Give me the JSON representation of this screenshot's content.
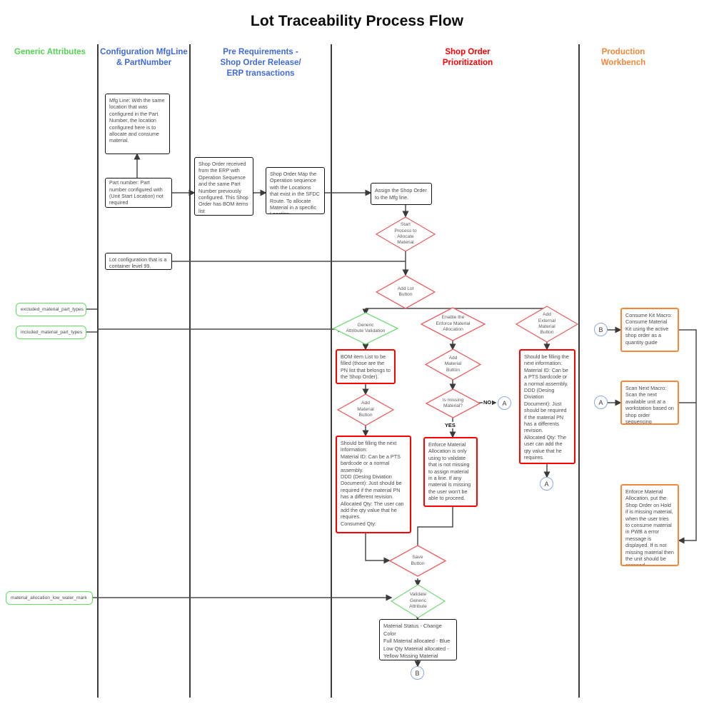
{
  "page": {
    "title": "Lot Traceability Process Flow",
    "background": "#ffffff"
  },
  "colors": {
    "lane_generic": "#55d455",
    "lane_config": "#4169e1",
    "lane_prereq": "#4169e1",
    "lane_shoporder": "#ff0000",
    "lane_workbench": "#f5873a",
    "box_black": "#111111",
    "box_red": "#ff0000",
    "box_orange": "#f5873a",
    "box_green": "#5fe05f",
    "diamond_red": "#f06060",
    "diamond_green": "#7bd97b",
    "connector": "#8fa7e0",
    "edge": "#4a4a4a"
  },
  "lanes": [
    {
      "id": "generic",
      "label": "Generic Attributes"
    },
    {
      "id": "config",
      "label": "Configuration MfgLine\n& PartNumber"
    },
    {
      "id": "prereq",
      "label": "Pre Requirements -\nShop Order Release/\nERP transactions"
    },
    {
      "id": "shoporder",
      "label": "Shop Order\nPrioritization"
    },
    {
      "id": "workbench",
      "label": "Production\nWorkbench"
    }
  ],
  "nodes": {
    "mfg_line": "Mfg Line: With the same location that was configured in the Part Number, the location configured here is to allocate and consume material.",
    "part_number": "Part number: Part number configured with (Unit Start Location) not required",
    "shop_order_erp": "Shop Order received from the ERP with Operation Sequence and the same Part Number previously configured. This Shop Order has BOM items list",
    "shop_order_map": "Shop Order Map the Operation sequence with the Locations that exist in the SFDC Route. To allocate Material in a specific Location",
    "assign_shop_order": "Assign the Shop Order to the Mfg line.",
    "lot_configuration": "Lot configuration that is a container level 99.",
    "excluded_material_part_types": "excluded_material_part_types",
    "included_material_part_types": "included_material_part_types",
    "material_allocation_low_water_mark": "material_allocation_low_water_mark",
    "bom_item_list": "BOM item List to be filled (those are the PN list that belongs to the Shop Order).",
    "should_be_filling_left": "Should be filling the next information:\nMaterial ID: Can be a PTS bardcode or a normal assembly.\nDDD (Desing Diviation Document): Just should be required if the material PN has a different revision.\nAllocated Qty: The user can add the qty value that he requires.\nConsumed Qty:",
    "enforce_material_allocation_note": "Enforce Material Allocation is only using to validate that is not missing to assign material in a line. If any material is missing the user won't be able to proceed.",
    "should_be_filling_right": "Should be filling the next information:\nMaterial ID: Can be a PTS bardcode or a normal assembly.\nDDD (Desing Diviation Document): Just should be required if the material PN has a differents revision.\nAllocated Qty: The user can add the qty value that he requires.\nConsumed Qty",
    "material_status": "Material Status - Change Color\nFull Material allocated - Blue\nLow Qty Material allocated - Yellow Missing Material allocated- Red",
    "consume_kit_macro": "Consume Kit Macro: Consume Material Kit using the active shop order as a quantity guide",
    "scan_next_macro": "Scan Next Macro: Scan the next available unit at a workstation based on shop order sequencing",
    "enforce_material_hold": "Enforce Material Allocation, put the Shop Order on Hold if is missing material, when the user tries to consume material in PWB a error message is displayed. If is not missing material then the unit should be scanned successfully."
  },
  "decisions": {
    "start_process": "Start\nProcess to\nAllocate\nMaterial",
    "add_lot_button": "Add Lot\nButton",
    "generic_attribute_validation": "Generic\nAttribute Validation",
    "enable_enforce": "Enable the\nEnforce Material\nAllocation",
    "add_material_button_right": "Add\nMaterial\nButton",
    "add_external_material_button": "Add\nExternal\nMaterial\nButton",
    "add_material_button_left": "Add\nMaterial\nButton",
    "is_missing_material": "Is missing\nMaterial?",
    "save_button": "Save\nButton",
    "validate_generic_attribute": "Validate\nGeneric\nAttribute"
  },
  "edge_labels": {
    "no": "NO",
    "yes": "YES"
  },
  "connectors": {
    "a1": "A",
    "a2": "A",
    "a3": "A",
    "b1": "B",
    "b2": "B"
  }
}
